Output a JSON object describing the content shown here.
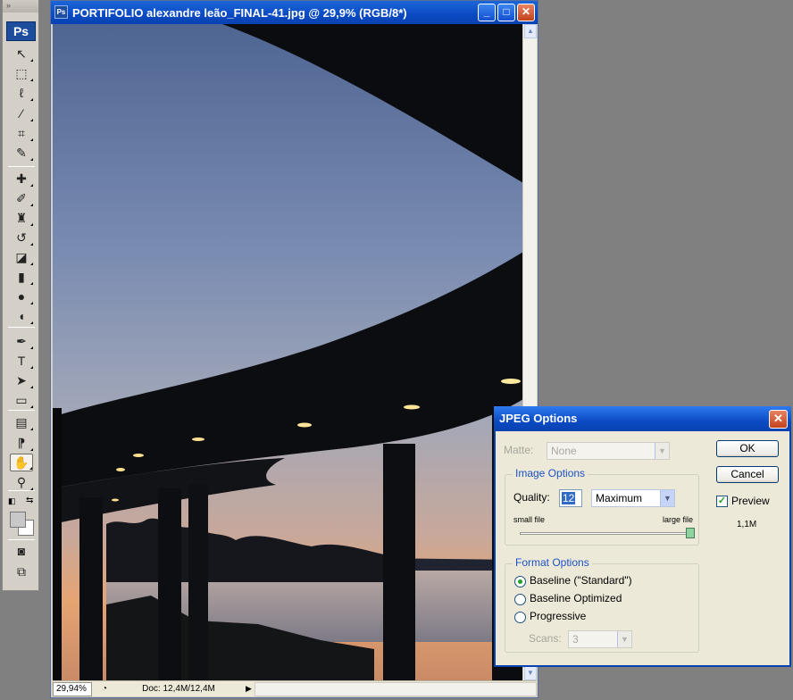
{
  "toolbox": {
    "grip": "»",
    "logo": "Ps",
    "tools": [
      {
        "name": "move-tool",
        "glyph": "↖"
      },
      {
        "name": "marquee-tool",
        "glyph": "⬚"
      },
      {
        "name": "lasso-tool",
        "glyph": "ℓ"
      },
      {
        "name": "magic-wand-tool",
        "glyph": "⁄"
      },
      {
        "name": "crop-tool",
        "glyph": "⌗"
      },
      {
        "name": "slice-tool",
        "glyph": "✎"
      },
      {
        "name": "healing-brush-tool",
        "glyph": "✚"
      },
      {
        "name": "brush-tool",
        "glyph": "✐"
      },
      {
        "name": "clone-stamp-tool",
        "glyph": "♜"
      },
      {
        "name": "history-brush-tool",
        "glyph": "↺"
      },
      {
        "name": "eraser-tool",
        "glyph": "◪"
      },
      {
        "name": "gradient-tool",
        "glyph": "▮"
      },
      {
        "name": "blur-tool",
        "glyph": "●"
      },
      {
        "name": "dodge-tool",
        "glyph": "◖"
      },
      {
        "name": "pen-tool",
        "glyph": "✒"
      },
      {
        "name": "type-tool",
        "glyph": "T"
      },
      {
        "name": "path-selection-tool",
        "glyph": "➤"
      },
      {
        "name": "shape-tool",
        "glyph": "▭"
      },
      {
        "name": "notes-tool",
        "glyph": "▤"
      },
      {
        "name": "eyedropper-tool",
        "glyph": "⁋"
      },
      {
        "name": "hand-tool",
        "glyph": "✋"
      },
      {
        "name": "zoom-tool",
        "glyph": "⚲"
      }
    ],
    "bottom_tools": [
      {
        "name": "quick-mask-button",
        "glyph": "◙"
      },
      {
        "name": "screen-mode-button",
        "glyph": "⧉"
      }
    ]
  },
  "document": {
    "title": "PORTIFOLIO alexandre leão_FINAL-41.jpg @ 29,9% (RGB/8*)",
    "icon": "Ps",
    "buttons": {
      "minimize": "_",
      "maximize": "□",
      "close": "✕"
    },
    "status": {
      "zoom": "29,94%",
      "doc_size": "Doc: 12,4M/12,4M",
      "menu_arrow": "▶"
    }
  },
  "dialog": {
    "title": "JPEG Options",
    "close": "✕",
    "matte_label": "Matte:",
    "matte_value": "None",
    "image_options": {
      "title": "Image Options",
      "quality_label": "Quality:",
      "quality_value": "12",
      "quality_preset": "Maximum",
      "small_file": "small file",
      "large_file": "large file",
      "slider_level": 1.0
    },
    "format_options": {
      "title": "Format Options",
      "options": [
        "Baseline (\"Standard\")",
        "Baseline Optimized",
        "Progressive"
      ],
      "selected": 0,
      "scans_label": "Scans:",
      "scans_value": "3"
    },
    "ok": "OK",
    "cancel": "Cancel",
    "preview_label": "Preview",
    "preview_checked": true,
    "file_size": "1,1M"
  },
  "colors": {
    "title_blue": "#0a4ac3",
    "group_title": "#1d52c6",
    "sky_top": "#5c6f9a",
    "sunset": "#e8a068"
  }
}
